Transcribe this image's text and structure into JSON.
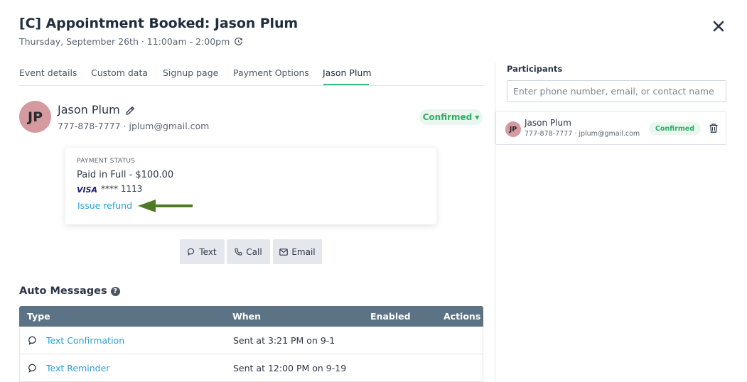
{
  "header": {
    "title": "[C] Appointment Booked: Jason Plum",
    "subtitle": "Thursday, September 26th · 11:00am - 2:00pm"
  },
  "tabs": [
    {
      "label": "Event details"
    },
    {
      "label": "Custom data"
    },
    {
      "label": "Signup page"
    },
    {
      "label": "Payment Options"
    },
    {
      "label": "Jason Plum",
      "active": true
    }
  ],
  "contact": {
    "initials": "JP",
    "name": "Jason Plum",
    "info": "777-878-7777 · jplum@gmail.com",
    "status": "Confirmed"
  },
  "payment": {
    "label": "PAYMENT STATUS",
    "amount": "Paid in Full - $100.00",
    "card_brand": "VISA",
    "card_last4": "**** 1113",
    "refund_link": "Issue refund"
  },
  "actions": [
    {
      "label": "Text",
      "icon": "chat-icon"
    },
    {
      "label": "Call",
      "icon": "phone-icon"
    },
    {
      "label": "Email",
      "icon": "mail-icon"
    }
  ],
  "auto_messages": {
    "title": "Auto Messages",
    "columns": [
      "Type",
      "When",
      "Enabled",
      "Actions"
    ],
    "rows": [
      {
        "type": "Text Confirmation",
        "when": "Sent at 3:21 PM on 9-1"
      },
      {
        "type": "Text Reminder",
        "when": "Sent at 12:00 PM on 9-19"
      }
    ]
  },
  "participants": {
    "label": "Participants",
    "placeholder": "Enter phone number, email, or contact name",
    "items": [
      {
        "initials": "JP",
        "name": "Jason Plum",
        "info": "777-878-7777 · jplum@gmail.com",
        "status": "Confirmed"
      }
    ]
  },
  "colors": {
    "accent_green": "#3fb97c",
    "link_blue": "#2d9fd8",
    "table_header": "#5b7384",
    "arrow_green": "#4e7a24",
    "avatar": "#d49a9f"
  }
}
